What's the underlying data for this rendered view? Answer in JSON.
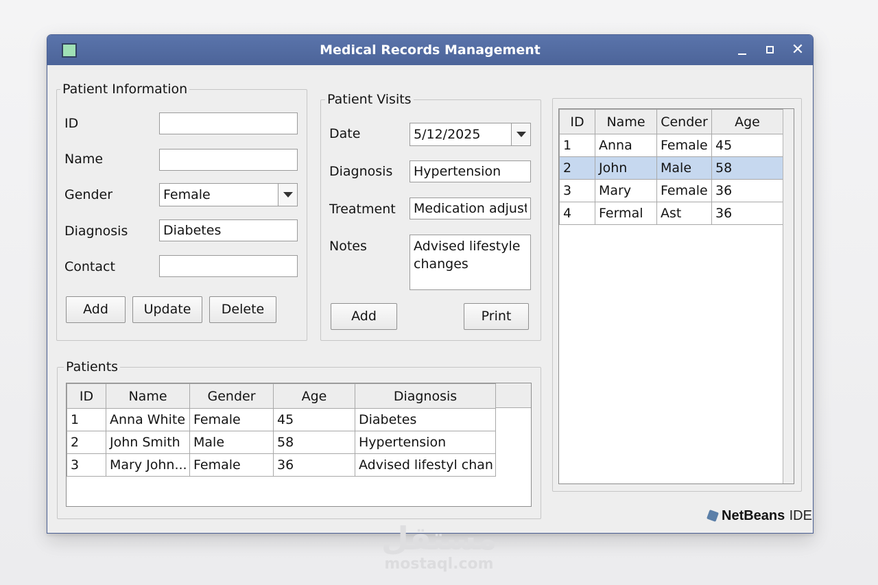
{
  "window": {
    "title": "Medical Records Management",
    "close_glyph": "✕"
  },
  "patient_info": {
    "legend": "Patient Information",
    "id_label": "ID",
    "id_value": "",
    "name_label": "Name",
    "name_value": "",
    "gender_label": "Gender",
    "gender_value": "Female",
    "diagnosis_label": "Diagnosis",
    "diagnosis_value": "Diabetes",
    "contact_label": "Contact",
    "contact_value": "",
    "add_label": "Add",
    "update_label": "Update",
    "delete_label": "Delete"
  },
  "patient_visits": {
    "legend": "Patient Visits",
    "date_label": "Date",
    "date_value": "5/12/2025",
    "diagnosis_label": "Diagnosis",
    "diagnosis_value": "Hypertension",
    "treatment_label": "Treatment",
    "treatment_value": "Medication adjust",
    "notes_label": "Notes",
    "notes_value": "Advised lifestyle\nchanges",
    "add_label": "Add",
    "print_label": "Print"
  },
  "patients": {
    "legend": "Patients",
    "columns": [
      "ID",
      "Name",
      "Gender",
      "Age",
      "Diagnosis"
    ],
    "rows": [
      [
        "1",
        "Anna White",
        "Female",
        "45",
        "Diabetes"
      ],
      [
        "2",
        "John Smith",
        "Male",
        "58",
        "Hypertension"
      ],
      [
        "3",
        "Mary John...",
        "Female",
        "36",
        "Advised lifestyl chan"
      ]
    ]
  },
  "right_table": {
    "columns": [
      "ID",
      "Name",
      "Cender",
      "Age"
    ],
    "rows": [
      [
        "1",
        "Anna",
        "Female",
        "45"
      ],
      [
        "2",
        "John",
        "Male",
        "58"
      ],
      [
        "3",
        "Mary",
        "Female",
        "36"
      ],
      [
        "4",
        "Fermal",
        "Ast",
        "36"
      ]
    ],
    "selected_row": 1,
    "selection_color": "#c6d8ef"
  },
  "branding": {
    "netbeans": "NetBeans",
    "ide": "IDE"
  },
  "watermark": {
    "logo": "مستقل",
    "url": "mostaql.com"
  },
  "colors": {
    "titlebar": "#4c6499",
    "app_icon": "#9fe0b5"
  }
}
